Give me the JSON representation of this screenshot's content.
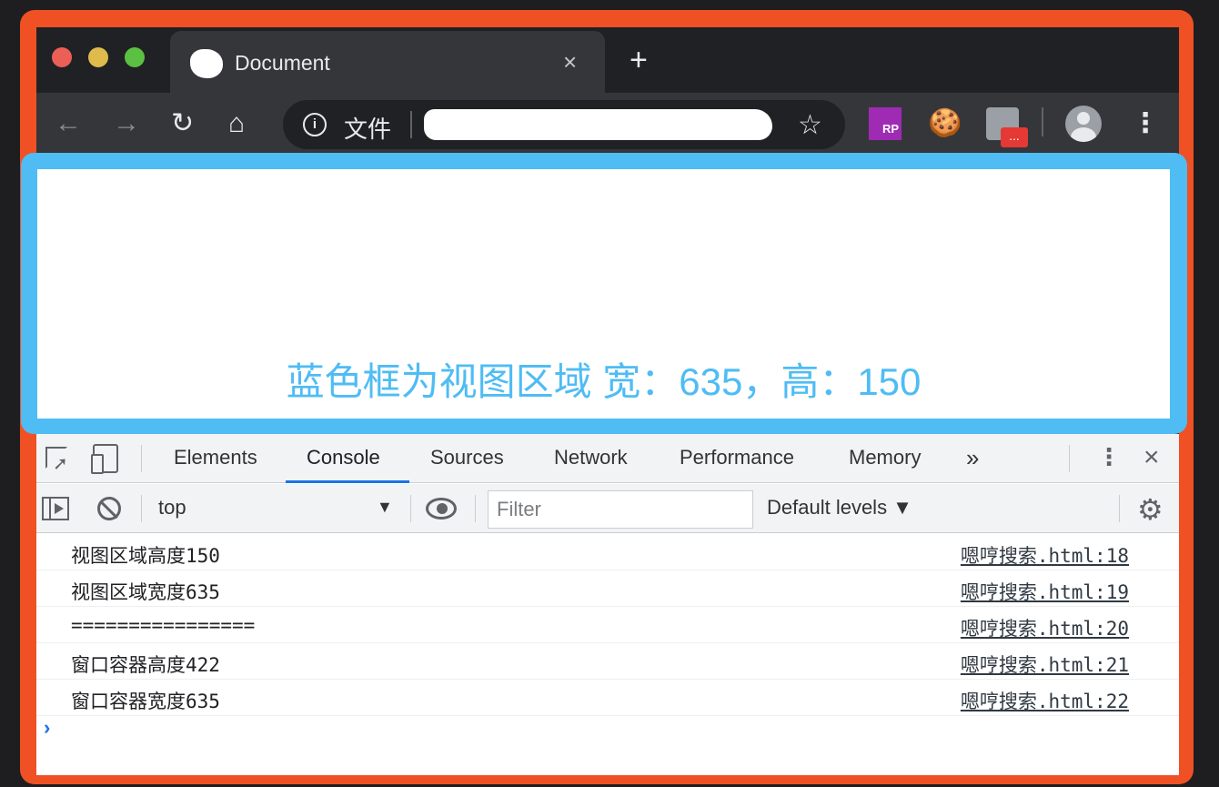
{
  "browser": {
    "tab_title": "Document",
    "tab_close": "×",
    "new_tab": "+",
    "address_label": "文件"
  },
  "extensions": {
    "rp_label": "RP",
    "badge_text": "..."
  },
  "page": {
    "viewport_text": "蓝色框为视图区域 宽：635，高：150",
    "accent_color": "#4fbcf4",
    "frame_color": "#ef5124"
  },
  "devtools": {
    "tabs": [
      "Elements",
      "Console",
      "Sources",
      "Network",
      "Performance",
      "Memory"
    ],
    "active_tab": "Console",
    "more_tabs": "»",
    "console": {
      "context": "top",
      "filter_placeholder": "Filter",
      "levels": "Default levels ▼",
      "logs": [
        {
          "text": "视图区域高度150",
          "source": "嗯哼搜索.html:18"
        },
        {
          "text": "视图区域宽度635",
          "source": "嗯哼搜索.html:19"
        },
        {
          "text": "================",
          "source": "嗯哼搜索.html:20"
        },
        {
          "text": "窗口容器高度422",
          "source": "嗯哼搜索.html:21"
        },
        {
          "text": "窗口容器宽度635",
          "source": "嗯哼搜索.html:22"
        }
      ],
      "prompt": "›"
    }
  }
}
